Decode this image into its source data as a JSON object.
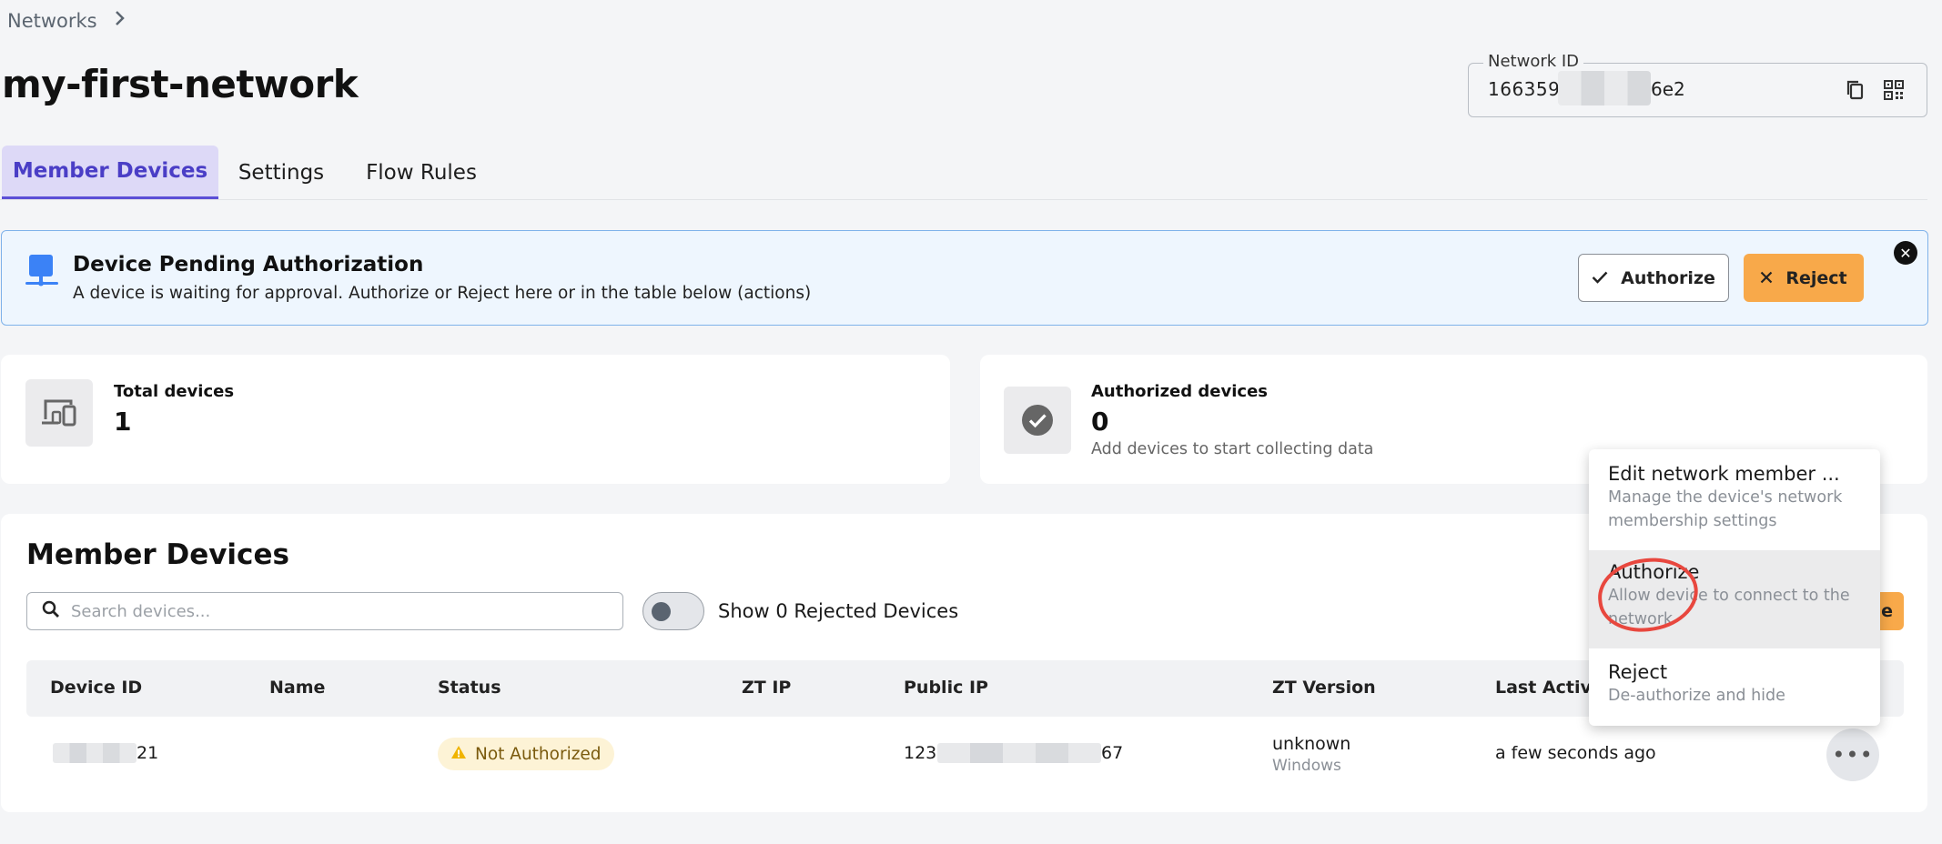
{
  "breadcrumb": {
    "root": "Networks"
  },
  "page": {
    "title": "my-first-network"
  },
  "network_id": {
    "label": "Network ID",
    "value_start": "166359",
    "value_end": "6e2"
  },
  "tabs": [
    {
      "label": "Member Devices",
      "active": true
    },
    {
      "label": "Settings",
      "active": false
    },
    {
      "label": "Flow Rules",
      "active": false
    }
  ],
  "alert": {
    "title": "Device Pending Authorization",
    "description": "A device is waiting for approval. Authorize or Reject here or in the table below (actions)",
    "authorize_label": "Authorize",
    "reject_label": "Reject",
    "close": "✕"
  },
  "stats": {
    "total": {
      "label": "Total devices",
      "value": "1"
    },
    "authorized": {
      "label": "Authorized devices",
      "value": "0",
      "subtitle": "Add devices to start collecting data"
    }
  },
  "member_devices": {
    "title": "Member Devices",
    "search_placeholder": "Search devices...",
    "toggle_label": "Show 0 Rejected Devices",
    "action_button_peek": "e",
    "columns": [
      "Device ID",
      "Name",
      "Status",
      "ZT IP",
      "Public IP",
      "ZT Version",
      "Last Active"
    ],
    "rows": [
      {
        "device_id_suffix": "21",
        "status": "Not Authorized",
        "public_ip_start": "123",
        "public_ip_end": "67",
        "zt_version": "unknown",
        "os": "Windows",
        "last_active": "a few seconds ago",
        "actions": "•••"
      }
    ]
  },
  "menu": {
    "items": [
      {
        "label": "Edit network member ...",
        "description": "Manage the device's network membership settings"
      },
      {
        "label": "Authorize",
        "description": "Allow device to connect to the network"
      },
      {
        "label": "Reject",
        "description": "De-authorize and hide"
      }
    ]
  },
  "colors": {
    "accent": "#5b4fd6",
    "active_tab_bg": "#ddd9f7",
    "alert_bg": "#eef6fe",
    "alert_border": "#7fb2ea",
    "reject_orange": "#f8a94a",
    "warning_badge_bg": "#fdf3d6",
    "annotation_red": "#e8473e"
  }
}
